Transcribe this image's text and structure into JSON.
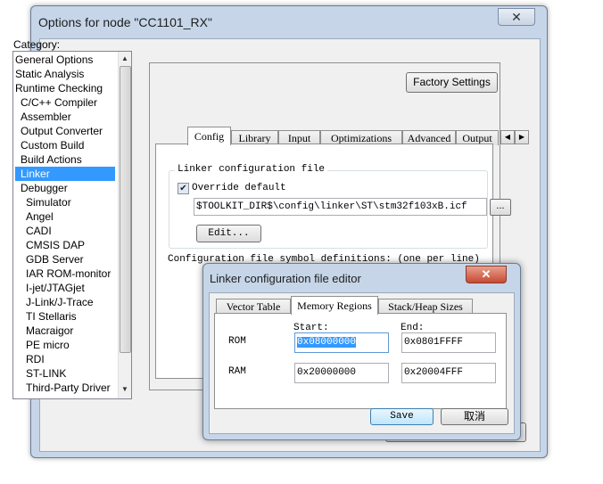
{
  "main_window": {
    "title": "Options for node \"CC1101_RX\"",
    "close_glyph": "✕"
  },
  "category": {
    "label": "Category:",
    "items": [
      {
        "label": "General Options"
      },
      {
        "label": "Static Analysis"
      },
      {
        "label": "Runtime Checking"
      },
      {
        "label": "C/C++ Compiler"
      },
      {
        "label": "Assembler"
      },
      {
        "label": "Output Converter"
      },
      {
        "label": "Custom Build"
      },
      {
        "label": "Build Actions"
      },
      {
        "label": "Linker"
      },
      {
        "label": "Debugger"
      },
      {
        "label": "Simulator"
      },
      {
        "label": "Angel"
      },
      {
        "label": "CADI"
      },
      {
        "label": "CMSIS DAP"
      },
      {
        "label": "GDB Server"
      },
      {
        "label": "IAR ROM-monitor"
      },
      {
        "label": "I-jet/JTAGjet"
      },
      {
        "label": "J-Link/J-Trace"
      },
      {
        "label": "TI Stellaris"
      },
      {
        "label": "Macraigor"
      },
      {
        "label": "PE micro"
      },
      {
        "label": "RDI"
      },
      {
        "label": "ST-LINK"
      },
      {
        "label": "Third-Party Driver"
      }
    ],
    "selected": "Linker"
  },
  "factory_button": "Factory Settings",
  "tabs": [
    "Config",
    "Library",
    "Input",
    "Optimizations",
    "Advanced",
    "Output"
  ],
  "active_tab": "Config",
  "linker_config": {
    "group_title": "Linker configuration file",
    "override_label": "Override default",
    "override_checked": true,
    "path": "$TOOLKIT_DIR$\\config\\linker\\ST\\stm32f103xB.icf",
    "browse_label": "...",
    "edit_label": "Edit..."
  },
  "symbol_defs_label": "Configuration file symbol definitions: (one per line)",
  "editor": {
    "title": "Linker configuration file editor",
    "close_glyph": "✕",
    "tabs": [
      "Vector Table",
      "Memory Regions",
      "Stack/Heap Sizes"
    ],
    "active_tab": "Memory Regions",
    "start_label": "Start:",
    "end_label": "End:",
    "rows": [
      {
        "name": "ROM",
        "start": "0x08000000",
        "end": "0x0801FFFF"
      },
      {
        "name": "RAM",
        "start": "0x20000000",
        "end": "0x20004FFF"
      }
    ],
    "save_label": "Save",
    "cancel_label": "取消"
  }
}
